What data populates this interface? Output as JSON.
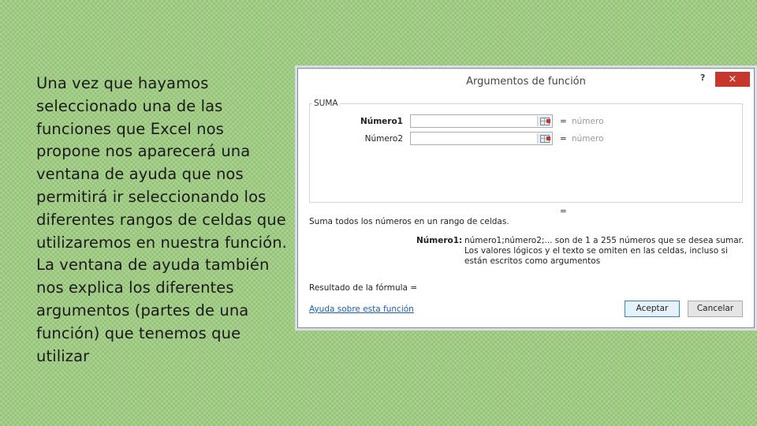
{
  "slide": {
    "text": "Una vez que hayamos\nseleccionado una de las\nfunciones que Excel nos\npropone nos aparecerá una\nventana de ayuda que nos\npermitirá ir seleccionando los\ndiferentes rangos de celdas que\nutilizaremos en nuestra función.\nLa ventana de ayuda también\nnos explica los diferentes\nargumentos (partes de una\nfunción) que tenemos que\nutilizar"
  },
  "dialog": {
    "title": "Argumentos de función",
    "help": "?",
    "close": "×",
    "function_name": "SUMA",
    "args": [
      {
        "label": "Número1",
        "value": "",
        "equals": "=",
        "hint": "número"
      },
      {
        "label": "Número2",
        "value": "",
        "equals": "=",
        "hint": "número"
      }
    ],
    "result_equals": "=",
    "description": "Suma todos los números en un rango de celdas.",
    "arg_description_name": "Número1:",
    "arg_description": "número1;número2;... son de 1 a 255 números que se desea sumar. Los valores lógicos y el texto se omiten en las celdas, incluso si están escritos como argumentos",
    "formula_result": "Resultado de la fórmula =",
    "help_link": "Ayuda sobre esta función",
    "ok_label": "Aceptar",
    "cancel_label": "Cancelar"
  },
  "colors": {
    "slide_background": "#a9d18e",
    "close_button": "#c8372b",
    "link": "#1a5fb4"
  },
  "icons": {
    "help": "help-icon",
    "close": "close-icon",
    "range_selector": "range-selector-icon"
  }
}
